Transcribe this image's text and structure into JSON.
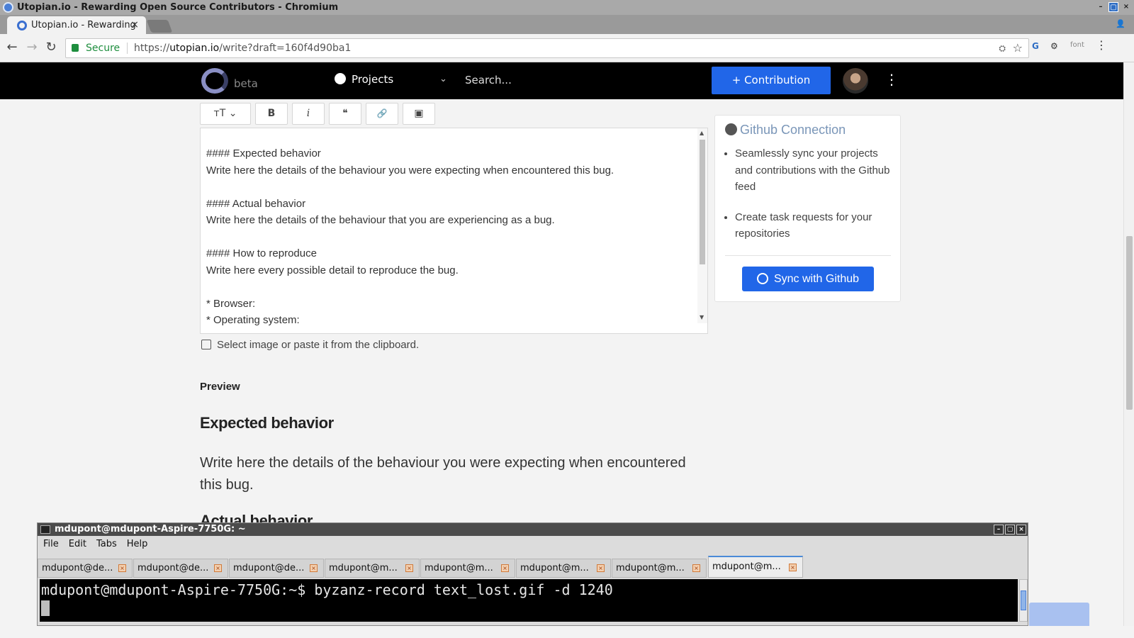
{
  "window": {
    "title": "Utopian.io - Rewarding Open Source Contributors - Chromium",
    "controls": [
      "–",
      "▢",
      "×"
    ]
  },
  "browser": {
    "tab_title": "Utopian.io - Rewarding",
    "tab_close": "×",
    "secure_label": "Secure",
    "url_prefix": "https://",
    "url_host": "utopian.io",
    "url_path": "/write?draft=160f4d90ba1",
    "ext_font_label": "font"
  },
  "site_header": {
    "logo_suffix": "beta",
    "projects_label": "Projects",
    "search_placeholder": "Search...",
    "contribution_button": "+ Contribution"
  },
  "editor": {
    "toolbar": {
      "heading": "ᴛT ⌄",
      "bold": "B",
      "italic": "i",
      "quote": "❝",
      "link": "🔗",
      "image": "▣"
    },
    "lines": [
      "#### Expected behavior",
      "Write here the details of the behaviour you were expecting when encountered this bug.",
      "",
      "#### Actual behavior",
      "Write here the details of the behaviour that you are experiencing as a bug.",
      "",
      "#### How to reproduce",
      "Write here every possible detail to reproduce the bug.",
      "",
      "* Browser:",
      "* Operating system:"
    ],
    "image_hint": "Select image or paste it from the clipboard."
  },
  "preview": {
    "label": "Preview",
    "heading1": "Expected behavior",
    "paragraph1": "Write here the details of the behaviour you were expecting when encountered this bug.",
    "heading2": "Actual behavior"
  },
  "github_card": {
    "title": "Github Connection",
    "bullets": [
      "Seamlessly sync your projects and contributions with the Github feed",
      "Create task requests for your repositories"
    ],
    "sync_button": "Sync with Github"
  },
  "terminal": {
    "title": "mdupont@mdupont-Aspire-7750G: ~",
    "menu": [
      "File",
      "Edit",
      "Tabs",
      "Help"
    ],
    "tabs": [
      "mdupont@de...",
      "mdupont@de...",
      "mdupont@de...",
      "mdupont@m...",
      "mdupont@m...",
      "mdupont@m...",
      "mdupont@m...",
      "mdupont@m..."
    ],
    "command_line": "mdupont@mdupont-Aspire-7750G:~$ byzanz-record text_lost.gif -d 1240"
  },
  "colors": {
    "accent": "#2166e8",
    "header_bg": "#000000",
    "secure_green": "#1e8e3e"
  }
}
